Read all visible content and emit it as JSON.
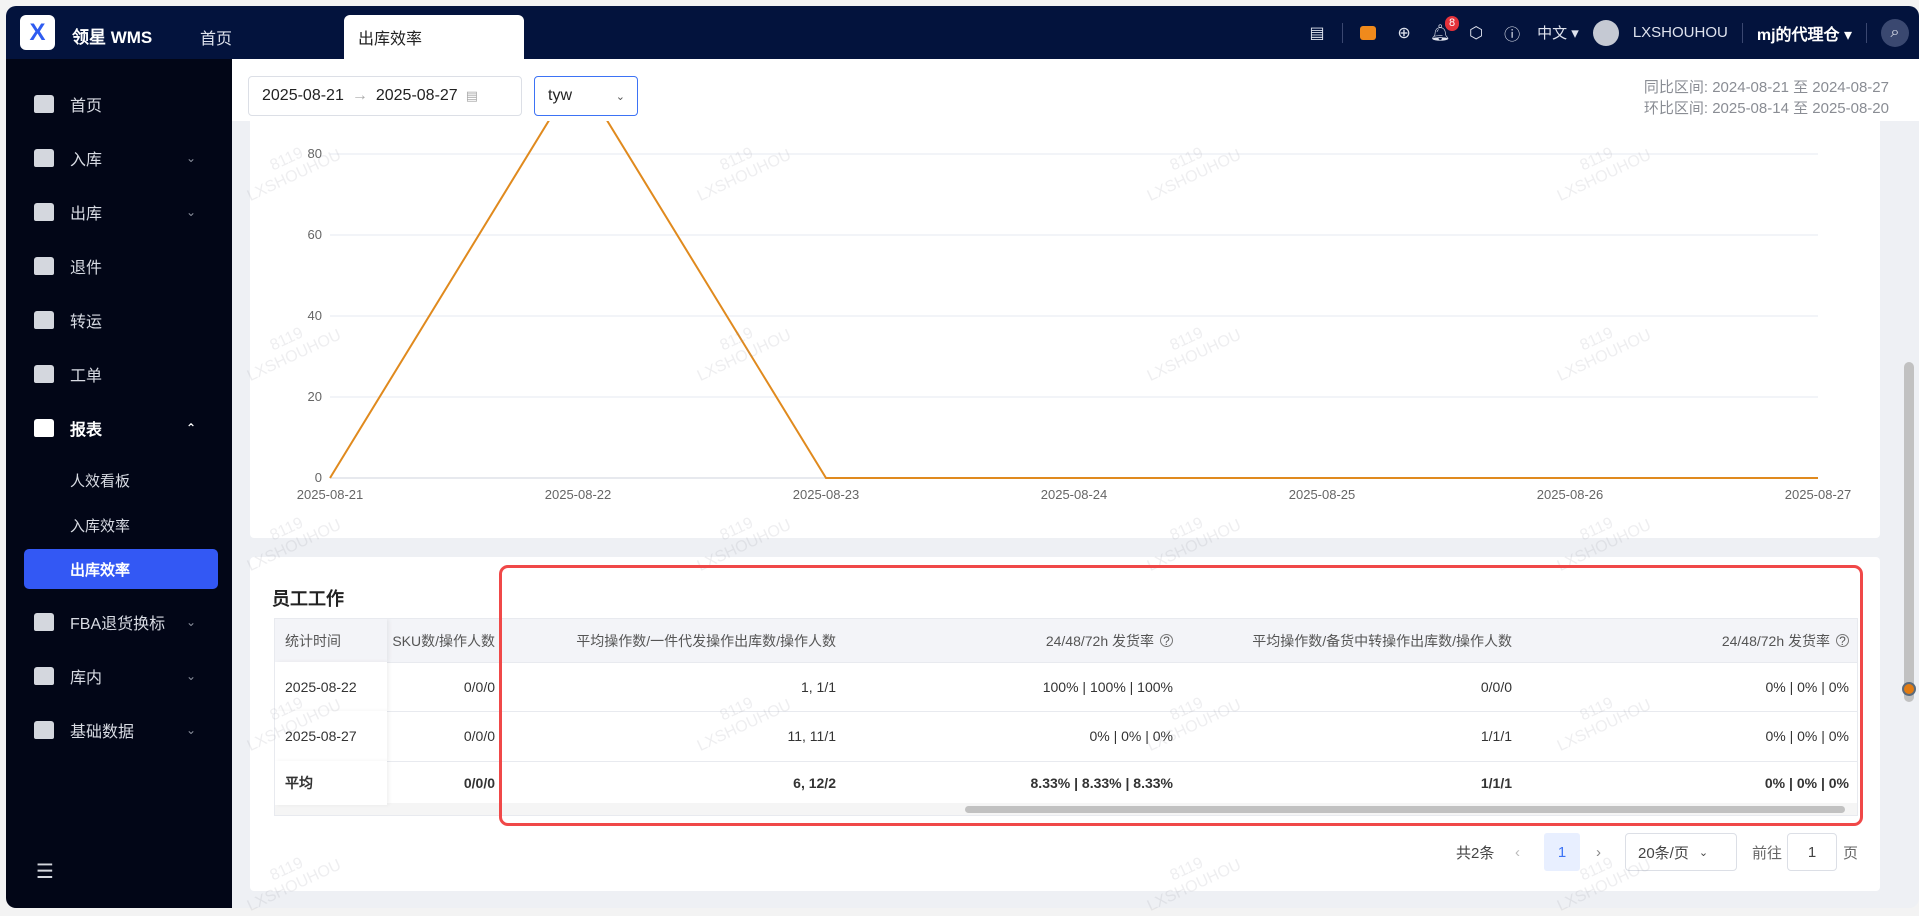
{
  "app": {
    "brand": "领星 WMS",
    "logo": "X"
  },
  "tabs": [
    {
      "label": "首页"
    },
    {
      "label": "出库效率"
    }
  ],
  "header": {
    "lang": "中文 ▾",
    "user": "LXSHOUHOU",
    "warehouse": "mj的代理仓 ▾",
    "notification_count": "8"
  },
  "sidebar": {
    "items": [
      {
        "label": "首页"
      },
      {
        "label": "入库"
      },
      {
        "label": "出库"
      },
      {
        "label": "退件"
      },
      {
        "label": "转运"
      },
      {
        "label": "工单"
      },
      {
        "label": "报表"
      },
      {
        "label": "人效看板"
      },
      {
        "label": "入库效率"
      },
      {
        "label": "出库效率"
      },
      {
        "label": "FBA退货换标"
      },
      {
        "label": "库内"
      },
      {
        "label": "基础数据"
      }
    ]
  },
  "filter": {
    "start": "2025-08-21",
    "end": "2025-08-27",
    "arrow": "→",
    "warehouse_select": "tyw",
    "yoy": "同比区间:  2024-08-21 至 2024-08-27",
    "mom": "环比区间:  2025-08-14 至 2025-08-20"
  },
  "chart_data": {
    "type": "line",
    "x": [
      "2025-08-21",
      "2025-08-22",
      "2025-08-23",
      "2025-08-24",
      "2025-08-25",
      "2025-08-26",
      "2025-08-27"
    ],
    "values": [
      0,
      100,
      0,
      0,
      0,
      0,
      0
    ],
    "yticks": [
      "0",
      "20",
      "40",
      "60",
      "80"
    ],
    "ylim": [
      0,
      80
    ],
    "color": "#e08a1e",
    "grid": true
  },
  "staff": {
    "title": "员工工作",
    "columns": [
      "统计时间",
      "SKU数/操作人数",
      "平均操作数/一件代发操作出库数/操作人数",
      "24/48/72h 发货率",
      "平均操作数/备货中转操作出库数/操作人数",
      "24/48/72h 发货率"
    ],
    "rows": [
      [
        "2025-08-22",
        "0/0/0",
        "1, 1/1",
        "100% | 100% | 100%",
        "0/0/0",
        "0% | 0% | 0%"
      ],
      [
        "2025-08-27",
        "0/0/0",
        "11, 11/1",
        "0% | 0% | 0%",
        "1/1/1",
        "0% | 0% | 0%"
      ],
      [
        "平均",
        "0/0/0",
        "6, 12/2",
        "8.33% | 8.33% | 8.33%",
        "1/1/1",
        "0% | 0% | 0%"
      ]
    ]
  },
  "pagination": {
    "total": "共2条",
    "page": "1",
    "size": "20条/页",
    "goto": "前往",
    "goto_value": "1",
    "page_unit": "页"
  },
  "watermark": "8119\nLXSHOUHOU"
}
